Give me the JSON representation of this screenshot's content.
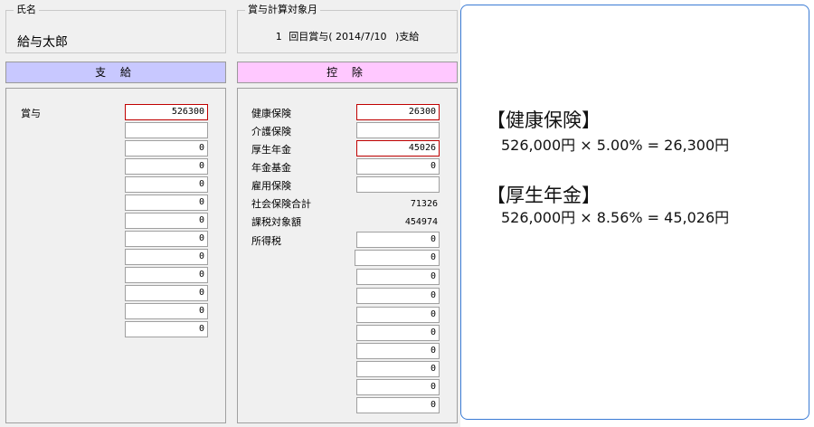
{
  "name_group": {
    "legend": "氏名",
    "value": "給与太郎"
  },
  "target_group": {
    "legend": "賞与計算対象月",
    "count": "1",
    "bonus_label": "回目賞与",
    "date_open": "(",
    "date": "2014/7/10",
    "date_close": ")支給"
  },
  "payment": {
    "header": "支 給",
    "label": "賞与",
    "bonus_value": "526300",
    "rows": [
      "",
      "0",
      "0",
      "0",
      "0",
      "0",
      "0",
      "0",
      "0",
      "0",
      "0",
      "0"
    ]
  },
  "deduction": {
    "header": "控 除",
    "items": [
      {
        "label": "健康保険",
        "value": "26300",
        "highlight": true
      },
      {
        "label": "介護保険",
        "value": ""
      },
      {
        "label": "厚生年金",
        "value": "45026",
        "highlight": true
      },
      {
        "label": "年金基金",
        "value": "0"
      },
      {
        "label": "雇用保険",
        "value": ""
      }
    ],
    "social_total": {
      "label": "社会保険合計",
      "value": "71326"
    },
    "taxable": {
      "label": "課税対象額",
      "value": "454974"
    },
    "income_tax": {
      "label": "所得税",
      "value": "0"
    },
    "extra_rows": [
      "0",
      "0",
      "0",
      "0",
      "0",
      "0",
      "0",
      "0",
      "0"
    ]
  },
  "explanation": {
    "health_title": "【健康保険】",
    "health_formula": "526,000円 × 5.00% = 26,300円",
    "pension_title": "【厚生年金】",
    "pension_formula": "526,000円 × 8.56% = 45,026円",
    "border_color": "#3a7bd5"
  }
}
